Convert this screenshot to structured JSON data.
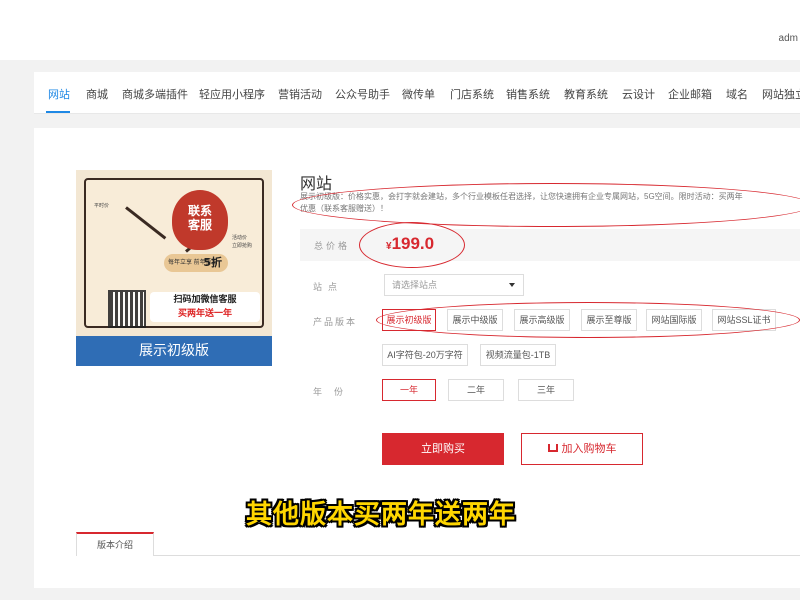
{
  "header": {
    "user": "adm"
  },
  "nav": {
    "items": [
      "网站",
      "商城",
      "商城多端插件",
      "轻应用小程序",
      "营销活动",
      "公众号助手",
      "微传单",
      "门店系统",
      "销售系统",
      "教育系统",
      "云设计",
      "企业邮箱",
      "域名",
      "网站独立"
    ]
  },
  "product": {
    "image": {
      "flame_text_1": "联系",
      "flame_text_2": "客服",
      "badge_small": "每年立享 前年折扣",
      "badge_big": "5折",
      "qr_line1": "扫码加微信客服",
      "qr_line2": "买两年送一年",
      "left_small": "平时价",
      "right_small_1": "活动价",
      "right_small_2": "立即抢购",
      "banner": "展示初级版"
    },
    "title": "网站",
    "description_line1": "展示初级版：价格实惠，会打字就会建站，多个行业模板任君选择，让您快速拥有企业专属网站，5G空间。限时活动：买两年",
    "description_line2": "优惠（联系客服赠送）！",
    "price_label": "总价格",
    "currency": "¥",
    "price": "199.0",
    "site_label": "站点",
    "site_placeholder": "请选择站点",
    "product_label": "产品版本",
    "versions": [
      "展示初级版",
      "展示中级版",
      "展示高级版",
      "展示至尊版",
      "网站国际版",
      "网站SSL证书"
    ],
    "addons": [
      "AI字符包-20万字符",
      "视频流量包-1TB"
    ],
    "year_label": "年份",
    "years": [
      "一年",
      "二年",
      "三年"
    ],
    "buy_label": "立即购买",
    "cart_label": "加入购物车",
    "tab_intro": "版本介绍"
  },
  "overlay": {
    "subtitle": "其他版本买两年送两年"
  },
  "colors": {
    "accent": "#d7282f",
    "nav_active": "#1e88e5",
    "subtitle": "#ffd600"
  }
}
